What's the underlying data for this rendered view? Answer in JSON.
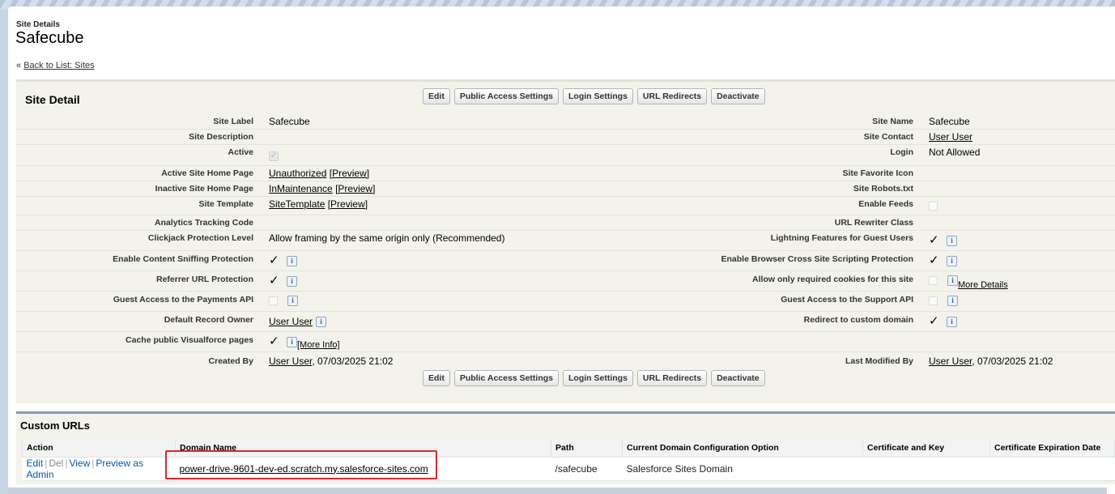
{
  "header": {
    "object_type": "Site Details",
    "title": "Safecube"
  },
  "backlink": {
    "prefix": "« ",
    "label": "Back to List: Sites"
  },
  "detail": {
    "title": "Site Detail",
    "buttons": [
      "Edit",
      "Public Access Settings",
      "Login Settings",
      "URL Redirects",
      "Deactivate"
    ],
    "rows": {
      "site_label": {
        "label": "Site Label",
        "value": "Safecube"
      },
      "site_name": {
        "label": "Site Name",
        "value": "Safecube"
      },
      "site_description": {
        "label": "Site Description",
        "value": ""
      },
      "site_contact": {
        "label": "Site Contact",
        "value": "User User"
      },
      "active": {
        "label": "Active",
        "checked": true
      },
      "login": {
        "label": "Login",
        "value": "Not Allowed"
      },
      "active_home": {
        "label": "Active Site Home Page",
        "link": "Unauthorized",
        "preview": "[Preview]"
      },
      "favicon": {
        "label": "Site Favorite Icon",
        "value": ""
      },
      "inactive_home": {
        "label": "Inactive Site Home Page",
        "link": "InMaintenance",
        "preview": "[Preview]"
      },
      "robots": {
        "label": "Site Robots.txt",
        "value": ""
      },
      "template": {
        "label": "Site Template",
        "link": "SiteTemplate",
        "preview": "[Preview]"
      },
      "feeds": {
        "label": "Enable Feeds",
        "checked": false
      },
      "analytics": {
        "label": "Analytics Tracking Code",
        "value": ""
      },
      "url_rewriter": {
        "label": "URL Rewriter Class",
        "value": ""
      },
      "clickjack": {
        "label": "Clickjack Protection Level",
        "value": "Allow framing by the same origin only (Recommended)"
      },
      "lightning_guest": {
        "label": "Lightning Features for Guest Users",
        "checked": true
      },
      "sniffing": {
        "label": "Enable Content Sniffing Protection",
        "checked": true
      },
      "xss": {
        "label": "Enable Browser Cross Site Scripting Protection",
        "checked": true
      },
      "referrer": {
        "label": "Referrer URL Protection",
        "checked": true
      },
      "cookies": {
        "label": "Allow only required cookies for this site",
        "checked": false,
        "more": "More Details"
      },
      "payments_api": {
        "label": "Guest Access to the Payments API",
        "checked": false
      },
      "support_api": {
        "label": "Guest Access to the Support API",
        "checked": false
      },
      "record_owner": {
        "label": "Default Record Owner",
        "value": "User User"
      },
      "redirect_domain": {
        "label": "Redirect to custom domain",
        "checked": true
      },
      "cache_vf": {
        "label": "Cache public Visualforce pages",
        "checked": true,
        "more": "[More Info]"
      },
      "created_by": {
        "label": "Created By",
        "user": "User User",
        "date": ", 07/03/2025 21:02"
      },
      "modified_by": {
        "label": "Last Modified By",
        "user": "User User",
        "date": ", 07/03/2025 21:02"
      }
    },
    "info_glyph": "i",
    "check_glyph": "✓",
    "disabled_check_glyph": "✓"
  },
  "custom_urls": {
    "title": "Custom URLs",
    "columns": [
      "Action",
      "Domain Name",
      "Path",
      "Current Domain Configuration Option",
      "Certificate and Key",
      "Certificate Expiration Date"
    ],
    "row": {
      "actions": {
        "edit": "Edit",
        "del": "Del",
        "view": "View",
        "preview": "Preview as Admin",
        "sep": "|"
      },
      "domain": "power-drive-9601-dev-ed.scratch.my.salesforce-sites.com",
      "path": "/safecube",
      "config": "Salesforce Sites Domain",
      "cert": "",
      "expiry": ""
    }
  },
  "colors": {
    "highlight": "#e0262b",
    "link": "#015ba7",
    "panel": "#f3f3ec"
  }
}
